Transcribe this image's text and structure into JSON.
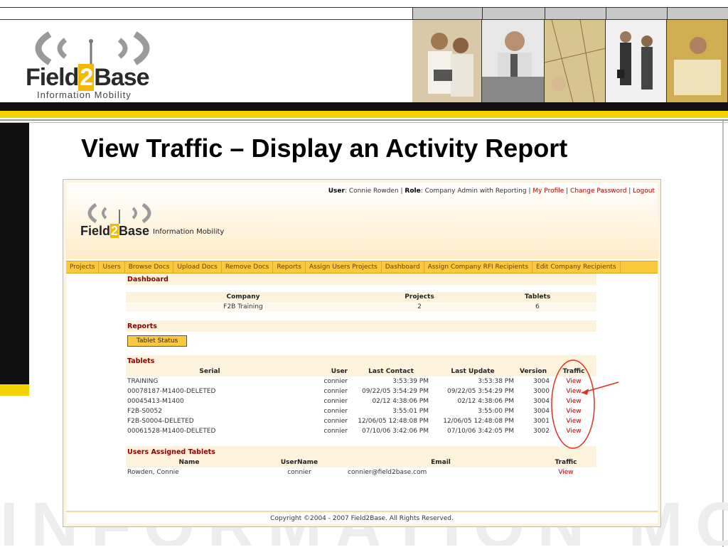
{
  "slide": {
    "title": "View Traffic – Display an Activity Report",
    "logo": {
      "name": "Field2Base",
      "name_pre": "Field",
      "name_two": "2",
      "name_post": "Base",
      "tagline": "Information Mobility"
    },
    "watermark": "INFORMATION MOBILITY"
  },
  "app": {
    "userline": {
      "user_label": "User",
      "user_value": "Connie Rowden",
      "role_label": "Role",
      "role_value": "Company Admin with Reporting",
      "links": [
        "My Profile",
        "Change Password",
        "Logout"
      ]
    },
    "logo": {
      "pre": "Field",
      "two": "2",
      "post": "Base",
      "tagline": "Information Mobility"
    },
    "nav": [
      "Projects",
      "Users",
      "Browse Docs",
      "Upload Docs",
      "Remove Docs",
      "Reports",
      "Assign Users Projects",
      "Dashboard",
      "Assign Company RFI Recipients",
      "Edit Company Recipients"
    ],
    "dashboard": {
      "heading": "Dashboard",
      "columns": [
        "Company",
        "Projects",
        "Tablets"
      ],
      "row": [
        "F2B Training",
        "2",
        "6"
      ]
    },
    "reports": {
      "heading": "Reports",
      "button": "Tablet Status"
    },
    "tablets": {
      "heading": "Tablets",
      "columns": [
        "Serial",
        "User",
        "Last Contact",
        "Last Update",
        "Version",
        "Traffic"
      ],
      "rows": [
        [
          "TRAINING",
          "connier",
          "3:53:39 PM",
          "3:53:38 PM",
          "3004",
          "View"
        ],
        [
          "00078187-M1400-DELETED",
          "connier",
          "09/22/05 3:54:29 PM",
          "09/22/05 3:54:29 PM",
          "3000",
          "View"
        ],
        [
          "00045413-M1400",
          "connier",
          "02/12 4:38:06 PM",
          "02/12 4:38:06 PM",
          "3004",
          "View"
        ],
        [
          "F2B-S0052",
          "connier",
          "3:55:01 PM",
          "3:55:00 PM",
          "3004",
          "View"
        ],
        [
          "F2B-S0004-DELETED",
          "connier",
          "12/06/05 12:48:08 PM",
          "12/06/05 12:48:08 PM",
          "3001",
          "View"
        ],
        [
          "00061528-M1400-DELETED",
          "connier",
          "07/10/06 3:42:06 PM",
          "07/10/06 3:42:05 PM",
          "3002",
          "View"
        ]
      ]
    },
    "users_assigned": {
      "heading": "Users Assigned Tablets",
      "columns": [
        "Name",
        "UserName",
        "Email",
        "Traffic"
      ],
      "rows": [
        [
          "Rowden, Connie",
          "connier",
          "connier@field2base.com",
          "View"
        ]
      ]
    },
    "footer": "Copyright ©2004 - 2007 Field2Base. All Rights Reserved."
  },
  "colors": {
    "accent_yellow": "#f5d300",
    "nav_orange": "#fbc93d",
    "link_red": "#b40000",
    "section_red": "#8b0000",
    "annotation_red": "#e0301e"
  }
}
